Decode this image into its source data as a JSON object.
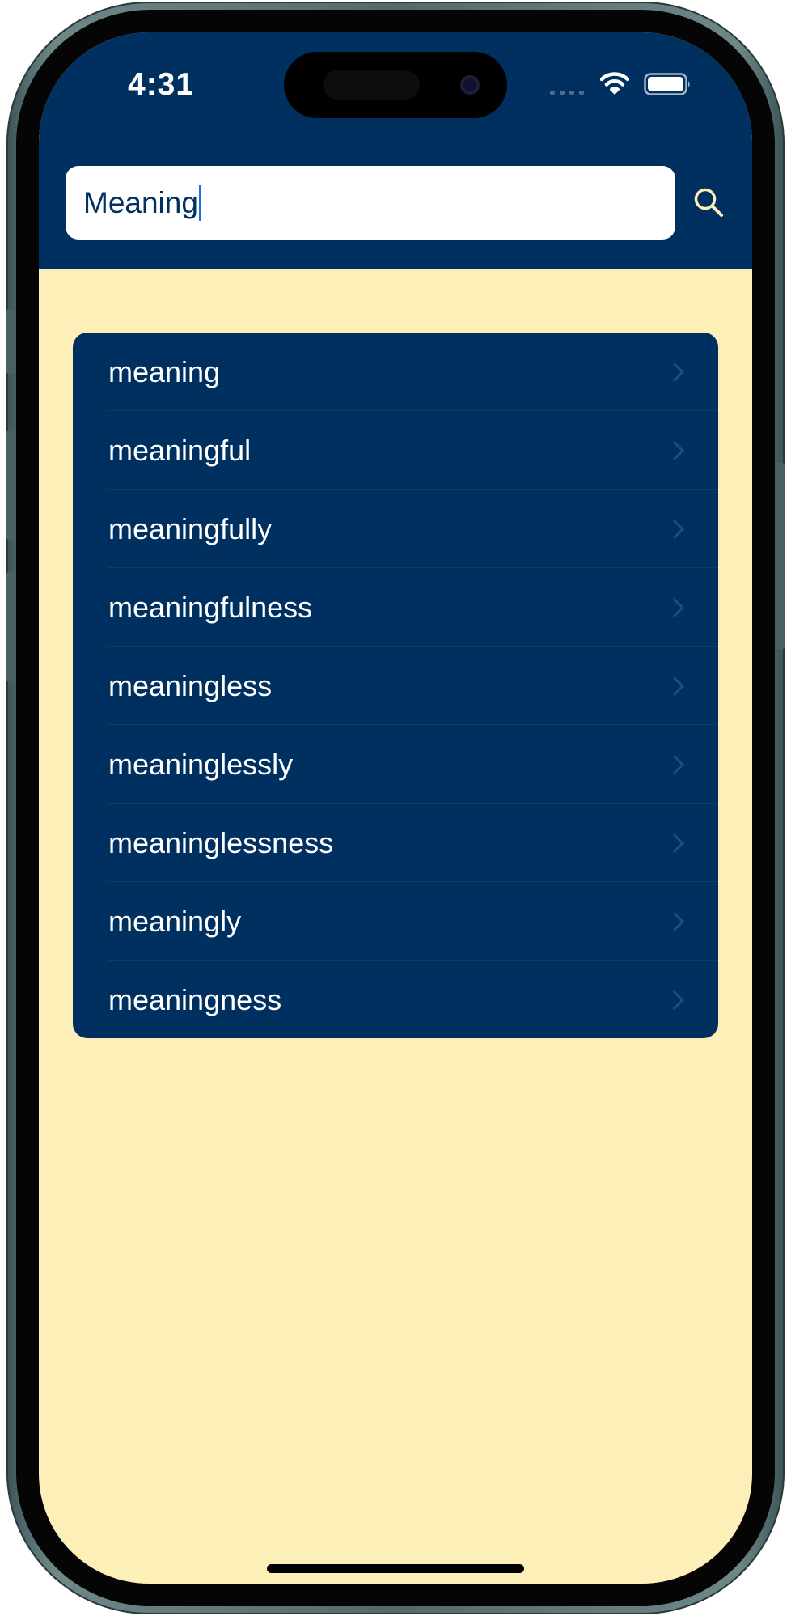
{
  "status_bar": {
    "time": "4:31"
  },
  "search": {
    "value": "Meaning",
    "placeholder": ""
  },
  "results": [
    {
      "label": "meaning"
    },
    {
      "label": "meaningful"
    },
    {
      "label": "meaningfully"
    },
    {
      "label": "meaningfulness"
    },
    {
      "label": "meaningless"
    },
    {
      "label": "meaninglessly"
    },
    {
      "label": "meaninglessness"
    },
    {
      "label": "meaningly"
    },
    {
      "label": "meaningness"
    }
  ],
  "icons": {
    "search": "search-icon",
    "row_disclosure": "chevron-right-icon",
    "wifi": "wifi-icon",
    "battery": "battery-icon",
    "signal": "signal-icon"
  },
  "colors": {
    "header_bg": "#003060",
    "content_bg": "#fcf0b8",
    "list_bg": "#003060",
    "search_icon": "#fcf0b8",
    "caret": "#1b6fe0"
  }
}
